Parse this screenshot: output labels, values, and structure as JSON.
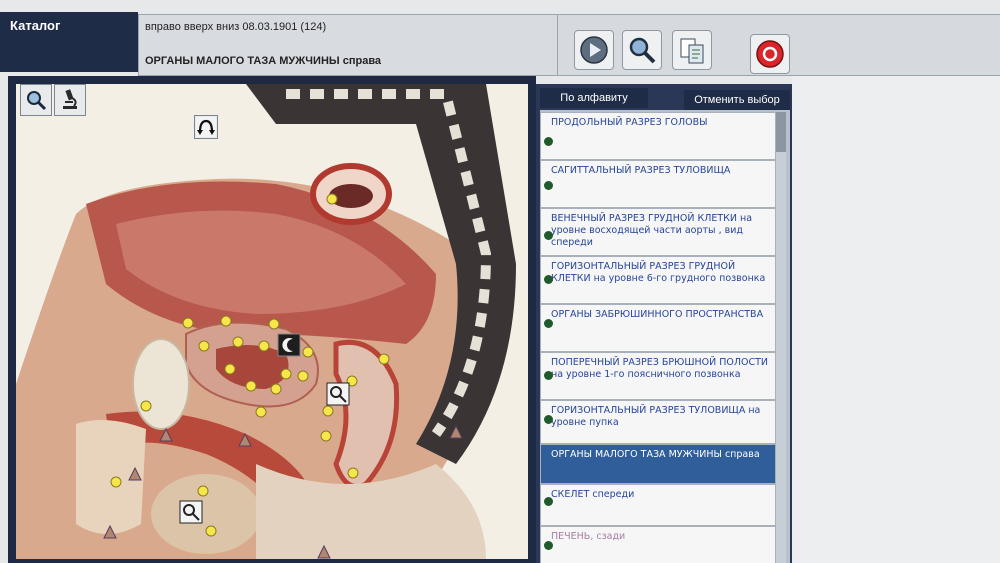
{
  "header": {
    "catalog_label": "Каталог",
    "info_line1": "вправо  вверх  вниз  08.03.1901 (124)",
    "info_line2": "ОРГАНЫ МАЛОГО ТАЗА МУЖЧИНЫ справа"
  },
  "toolbar": {
    "buttons": [
      "play-icon",
      "search-icon",
      "document-icon",
      "power-icon"
    ]
  },
  "viewer": {
    "tools": [
      "magnifier-icon",
      "microscope-icon"
    ],
    "rotate_icon": "rotate-icon"
  },
  "list": {
    "sort_tab": "По алфавиту",
    "cancel_tab": "Отменить выбор",
    "items": [
      {
        "label": "ПРОДОЛЬНЫЙ  РАЗРЕЗ  ГОЛОВЫ"
      },
      {
        "label": "САГИТТАЛЬНЫЙ  РАЗРЕЗ  ТУЛОВИЩА"
      },
      {
        "label": "ВЕНЕЧНЫЙ РАЗРЕЗ ГРУДНОЙ КЛЕТКИ на уровне восходящей части аорты , вид спереди"
      },
      {
        "label": "ГОРИЗОНТАЛЬНЫЙ РАЗРЕЗ ГРУДНОЙ КЛЕТКИ на уровне 6-го грудного позвонка"
      },
      {
        "label": "ОРГАНЫ ЗАБРЮШИННОГО ПРОСТРАНСТВА"
      },
      {
        "label": "ПОПЕРЕЧНЫЙ  РАЗРЕЗ  БРЮШНОЙ  ПОЛОСТИ на уровне 1-го  поясничного позвонка"
      },
      {
        "label": "ГОРИЗОНТАЛЬНЫЙ  РАЗРЕЗ  ТУЛОВИЩА  на уровне  пупка"
      },
      {
        "label": "ОРГАНЫ МАЛОГО ТАЗА МУЖЧИНЫ справа"
      },
      {
        "label": "СКЕЛЕТ спереди"
      },
      {
        "label": "ПЕЧЕНЬ, сзади"
      }
    ]
  }
}
